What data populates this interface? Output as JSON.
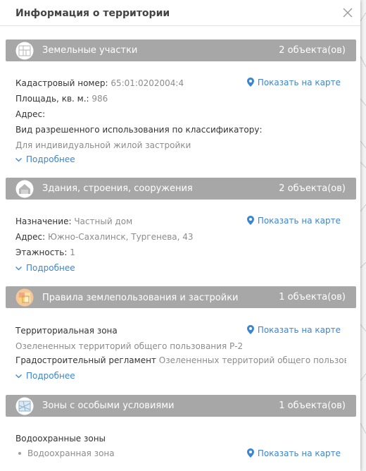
{
  "panel": {
    "title": "Информация о территории"
  },
  "map_link_label": "Показать на карте",
  "more_label": "Подробнее",
  "sections": [
    {
      "title": "Земельные участки",
      "count": "2 объекта(ов)",
      "icon": "land-plot-icon",
      "cadastral_label": "Кадастровый номер:",
      "cadastral_value": "65:01:0202004:4",
      "area_label": "Площадь, кв. м.:",
      "area_value": "986",
      "address_label": "Адрес:",
      "use_label": "Вид разрешенного использования по классификатору:",
      "use_value": "Для индивидуальной жилой застройки"
    },
    {
      "title": "Здания, строения, сооружения",
      "count": "2 объекта(ов)",
      "icon": "building-icon",
      "purpose_label": "Назначение:",
      "purpose_value": "Частный дом",
      "address_label": "Адрес:",
      "address_value": "Южно-Сахалинск, Тургенева, 43",
      "floors_label": "Этажность:",
      "floors_value": "1"
    },
    {
      "title": "Правила землепользования и застройки",
      "count": "1 объекта(ов)",
      "icon": "zoning-icon",
      "zone_label": "Территориальная зона",
      "zone_value": "Озелененных территорий общего пользования Р-2",
      "regulation_label": "Градостроительный регламент",
      "regulation_value": "Озелененных территорий общего пользования"
    },
    {
      "title": "Зоны с особыми условиями",
      "count": "1 объекта(ов)",
      "icon": "special-zone-icon",
      "type_label": "Водоохранные зоны",
      "item_value": "Водоохранная зона"
    }
  ],
  "colors": {
    "section_bar": "#a7a7a7",
    "link": "#3a86d4",
    "value_gray": "#8c8c8c"
  }
}
